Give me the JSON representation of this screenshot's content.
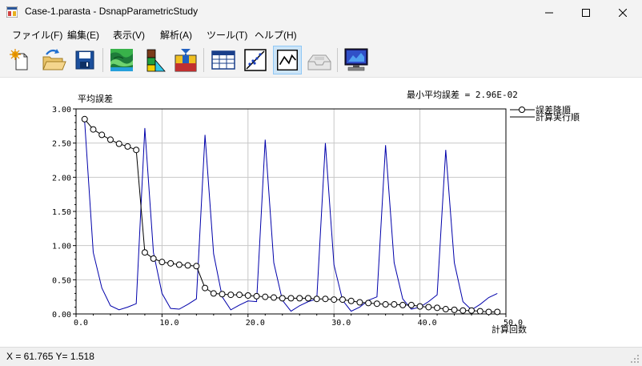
{
  "window": {
    "title": "Case-1.parasta - DsnapParametricStudy"
  },
  "menu": [
    {
      "label": "ファイル(F)"
    },
    {
      "label": "編集(E)"
    },
    {
      "label": "表示(V)"
    },
    {
      "label": "解析(A)"
    },
    {
      "label": "ツール(T)"
    },
    {
      "label": "ヘルプ(H)"
    }
  ],
  "toolbar": {
    "buttons": [
      {
        "icon": "new-icon"
      },
      {
        "icon": "open-icon"
      },
      {
        "icon": "save-icon"
      },
      {
        "icon": "contour-map-icon"
      },
      {
        "icon": "color-boxes-icon"
      },
      {
        "icon": "model-icon"
      },
      {
        "icon": "table-icon"
      },
      {
        "icon": "scatter-plot-icon"
      },
      {
        "icon": "line-chart-icon"
      },
      {
        "icon": "tray-icon"
      },
      {
        "icon": "monitor-icon"
      }
    ],
    "active": "line-chart-icon"
  },
  "chart": {
    "ylabel": "平均誤差",
    "xlabel": "計算回数",
    "annotation": "最小平均誤差 = 2.96E-02",
    "annotation_color": "#cc0000",
    "x_ticks": [
      "0.0",
      "10.0",
      "20.0",
      "30.0",
      "40.0",
      "50.0"
    ],
    "y_ticks": [
      "0.00",
      "0.50",
      "1.00",
      "1.50",
      "2.00",
      "2.50",
      "3.00"
    ]
  },
  "chart_data": {
    "type": "line",
    "xlim": [
      0,
      50
    ],
    "ylim": [
      0,
      3
    ],
    "grid": true,
    "legend_position": "top-right",
    "series": [
      {
        "name": "誤差降順",
        "color": "#000000",
        "marker": "circle",
        "x": [
          1,
          2,
          3,
          4,
          5,
          6,
          7,
          8,
          9,
          10,
          11,
          12,
          13,
          14,
          15,
          16,
          17,
          18,
          19,
          20,
          21,
          22,
          23,
          24,
          25,
          26,
          27,
          28,
          29,
          30,
          31,
          32,
          33,
          34,
          35,
          36,
          37,
          38,
          39,
          40,
          41,
          42,
          43,
          44,
          45,
          46,
          47,
          48,
          49
        ],
        "y": [
          2.85,
          2.7,
          2.62,
          2.55,
          2.49,
          2.45,
          2.4,
          0.9,
          0.81,
          0.76,
          0.74,
          0.72,
          0.71,
          0.7,
          0.38,
          0.3,
          0.29,
          0.28,
          0.28,
          0.27,
          0.26,
          0.25,
          0.24,
          0.23,
          0.23,
          0.23,
          0.23,
          0.22,
          0.22,
          0.21,
          0.21,
          0.19,
          0.17,
          0.16,
          0.15,
          0.14,
          0.14,
          0.13,
          0.13,
          0.11,
          0.1,
          0.09,
          0.07,
          0.06,
          0.05,
          0.05,
          0.04,
          0.03,
          0.03
        ]
      },
      {
        "name": "計算実行順",
        "color": "#0000aa",
        "marker": "none",
        "x": [
          1,
          2,
          3,
          4,
          5,
          6,
          7,
          8,
          9,
          10,
          11,
          12,
          13,
          14,
          15,
          16,
          17,
          18,
          19,
          20,
          21,
          22,
          23,
          24,
          25,
          26,
          27,
          28,
          29,
          30,
          31,
          32,
          33,
          34,
          35,
          36,
          37,
          38,
          39,
          40,
          41,
          42,
          43,
          44,
          45,
          46,
          47,
          48,
          49
        ],
        "y": [
          2.82,
          0.9,
          0.38,
          0.12,
          0.06,
          0.1,
          0.15,
          2.72,
          0.9,
          0.3,
          0.08,
          0.07,
          0.14,
          0.22,
          2.62,
          0.88,
          0.25,
          0.06,
          0.13,
          0.19,
          0.18,
          2.55,
          0.75,
          0.2,
          0.04,
          0.12,
          0.18,
          0.22,
          2.5,
          0.72,
          0.2,
          0.04,
          0.1,
          0.2,
          0.25,
          2.47,
          0.75,
          0.22,
          0.07,
          0.1,
          0.18,
          0.28,
          2.4,
          0.75,
          0.18,
          0.06,
          0.14,
          0.24,
          0.3
        ]
      }
    ]
  },
  "statusbar": {
    "text": "X = 61.765  Y= 1.518"
  }
}
